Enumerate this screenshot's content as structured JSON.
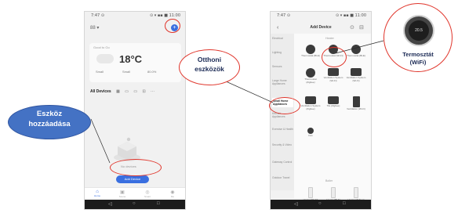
{
  "annotations": {
    "add_device": {
      "line1": "Eszköz",
      "line2": "hozzáadása"
    },
    "home_devices": {
      "line1": "Otthoni",
      "line2": "eszközök"
    },
    "thermostat": {
      "line1": "Termosztát",
      "line2": "(WiFi)",
      "display": "20.5"
    }
  },
  "phone1": {
    "status_left": "7:47 ⊙",
    "status_right": "⊙ ▾ ▪▪ ■ 11:00",
    "home_label": "88 ▾",
    "plus_icon": "+",
    "weather": {
      "label": "Good to Go",
      "temp": "18°C",
      "stat1": "Small",
      "stat2": "Small",
      "stat3": "80.0%"
    },
    "tabs": [
      "All Devices",
      "▦",
      "▭",
      "▭",
      "⊡",
      "···"
    ],
    "no_device_text": "No devices",
    "add_device_button": "Add Device",
    "bottom_tabs": [
      "Home",
      "Scene",
      "Smart",
      "Me"
    ],
    "nav": [
      "◁",
      "○",
      "□"
    ]
  },
  "phone2": {
    "status_left": "7:47 ⊙",
    "status_right": "⊙ ▾ ▪▪ ■ 11:00",
    "back_icon": "‹",
    "title": "Add Device",
    "scan_icons": [
      "⊙",
      "⊟"
    ],
    "sidebar": [
      "Electrical",
      "Lighting",
      "Sensors",
      "Large Home Appliances",
      "Small Home Appliances",
      "Kitchen Appliances",
      "Exercise & Health",
      "Security & Video",
      "Gateway Control",
      "Outdoor Travel"
    ],
    "selected_index": 4,
    "sections": [
      "Heater",
      "Boiler"
    ],
    "devices": [
      {
        "cap": "Thermostat (BLE)"
      },
      {
        "cap": "Thermostat (Wi-Fi)"
      },
      {
        "cap": "Thermostat (BLE)"
      },
      {
        "cap": "Thermostat (Zigbee)"
      },
      {
        "cap": "Ventilation System (Wi-Fi)"
      },
      {
        "cap": "Ventilation System (Wi-Fi)"
      },
      {
        "cap": "Ventilation System (Zigbee)"
      },
      {
        "cap": "Tile (Zigbee)"
      },
      {
        "cap": "Ventilation (Wi-Fi)"
      },
      {
        "cap": "Fan"
      },
      {
        "cap": "Heater (Wi-Fi)"
      },
      {
        "cap": "Heater (BLE)"
      },
      {
        "cap": "Heater (Zigbee)"
      }
    ],
    "nav": [
      "◁",
      "○",
      "□"
    ]
  },
  "colors": {
    "accent": "#3a6fe0",
    "callout_red": "#e0352b",
    "callout_blue": "#4472c4",
    "label_navy": "#1b2a55"
  }
}
